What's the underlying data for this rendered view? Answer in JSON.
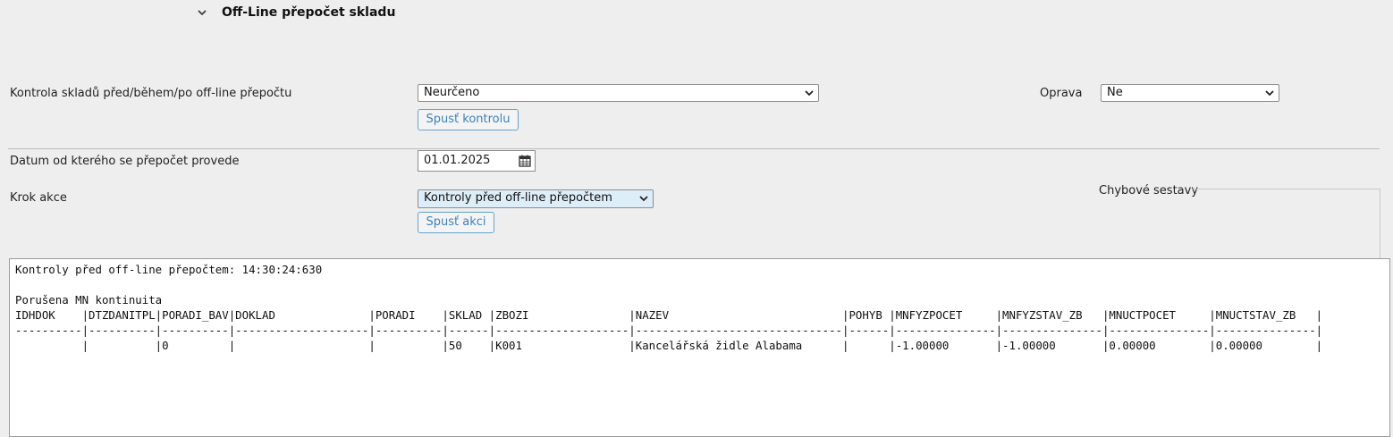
{
  "section": {
    "title": "Off-Line přepočet skladu",
    "toggle_icon": "chevron-down-icon"
  },
  "check": {
    "label": "Kontrola skladů před/během/po off-line přepočtu",
    "select_value": "Neurčeno",
    "button_label": "Spusť kontrolu"
  },
  "fix": {
    "label": "Oprava",
    "select_value": "Ne"
  },
  "date": {
    "label": "Datum od kterého se přepočet provede",
    "value": "01.01.2025",
    "icon": "calendar-icon"
  },
  "step": {
    "label": "Krok akce",
    "select_value": "Kontroly před off-line přepočtem",
    "button_label": "Spusť akci"
  },
  "error_reports": {
    "legend": "Chybové sestavy"
  },
  "output": {
    "header_line": "Kontroly před off-line přepočtem: 14:30:24:630",
    "blank_line": "",
    "message_line": "Porušena MN kontinuita",
    "columns_line": "IDHDOK    |DTZDANITPL|PORADI_BAV|DOKLAD              |PORADI    |SKLAD |ZBOZI               |NAZEV                          |POHYB |MNFYZPOCET     |MNFYZSTAV_ZB   |MNUCTPOCET     |MNUCTSTAV_ZB   |",
    "separator_line": "----------|----------|----------|--------------------|----------|------|--------------------|-------------------------------|------|---------------|---------------|---------------|---------------|",
    "row_line": "          |          |0         |                    |          |50    |K001                |Kancelářská židle Alabama      |      |-1.00000       |-1.00000       |0.00000        |0.00000        |"
  },
  "colors": {
    "background": "#eeeeee",
    "button_border": "#63a4cc",
    "button_text": "#3b82b8",
    "highlight_select": "#ddeef8"
  }
}
